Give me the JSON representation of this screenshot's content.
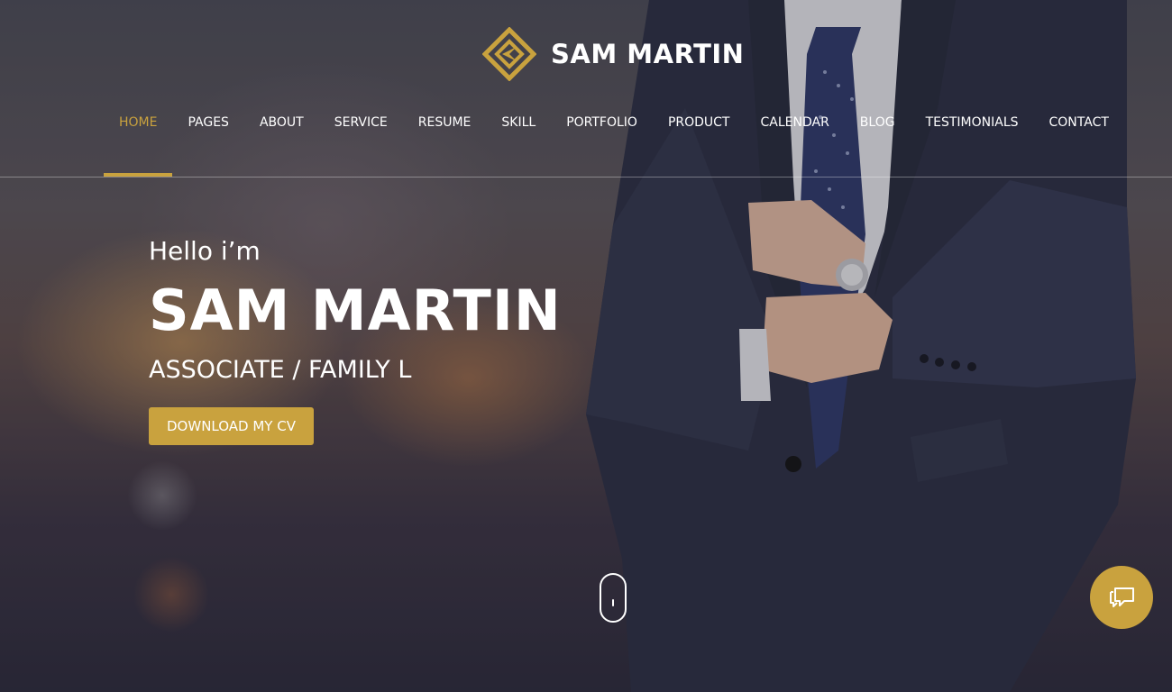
{
  "brand": {
    "name": "SAM MARTIN",
    "logo_icon": "diamond-logo-icon",
    "accent_color": "#c9a23e"
  },
  "nav": {
    "items": [
      {
        "label": "HOME",
        "active": true
      },
      {
        "label": "PAGES",
        "active": false
      },
      {
        "label": "ABOUT",
        "active": false
      },
      {
        "label": "SERVICE",
        "active": false
      },
      {
        "label": "RESUME",
        "active": false
      },
      {
        "label": "SKILL",
        "active": false
      },
      {
        "label": "PORTFOLIO",
        "active": false
      },
      {
        "label": "PRODUCT",
        "active": false
      },
      {
        "label": "CALENDAR",
        "active": false
      },
      {
        "label": "BLOG",
        "active": false
      },
      {
        "label": "TESTIMONIALS",
        "active": false
      },
      {
        "label": "CONTACT",
        "active": false
      }
    ]
  },
  "hero": {
    "greeting": "Hello i’m",
    "name": "SAM MARTIN",
    "role": "ASSOCIATE / FAMILY L",
    "cta_label": "DOWNLOAD MY CV"
  },
  "widgets": {
    "scroll_icon": "scroll-mouse-icon",
    "chat_icon": "chat-bubble-icon"
  }
}
